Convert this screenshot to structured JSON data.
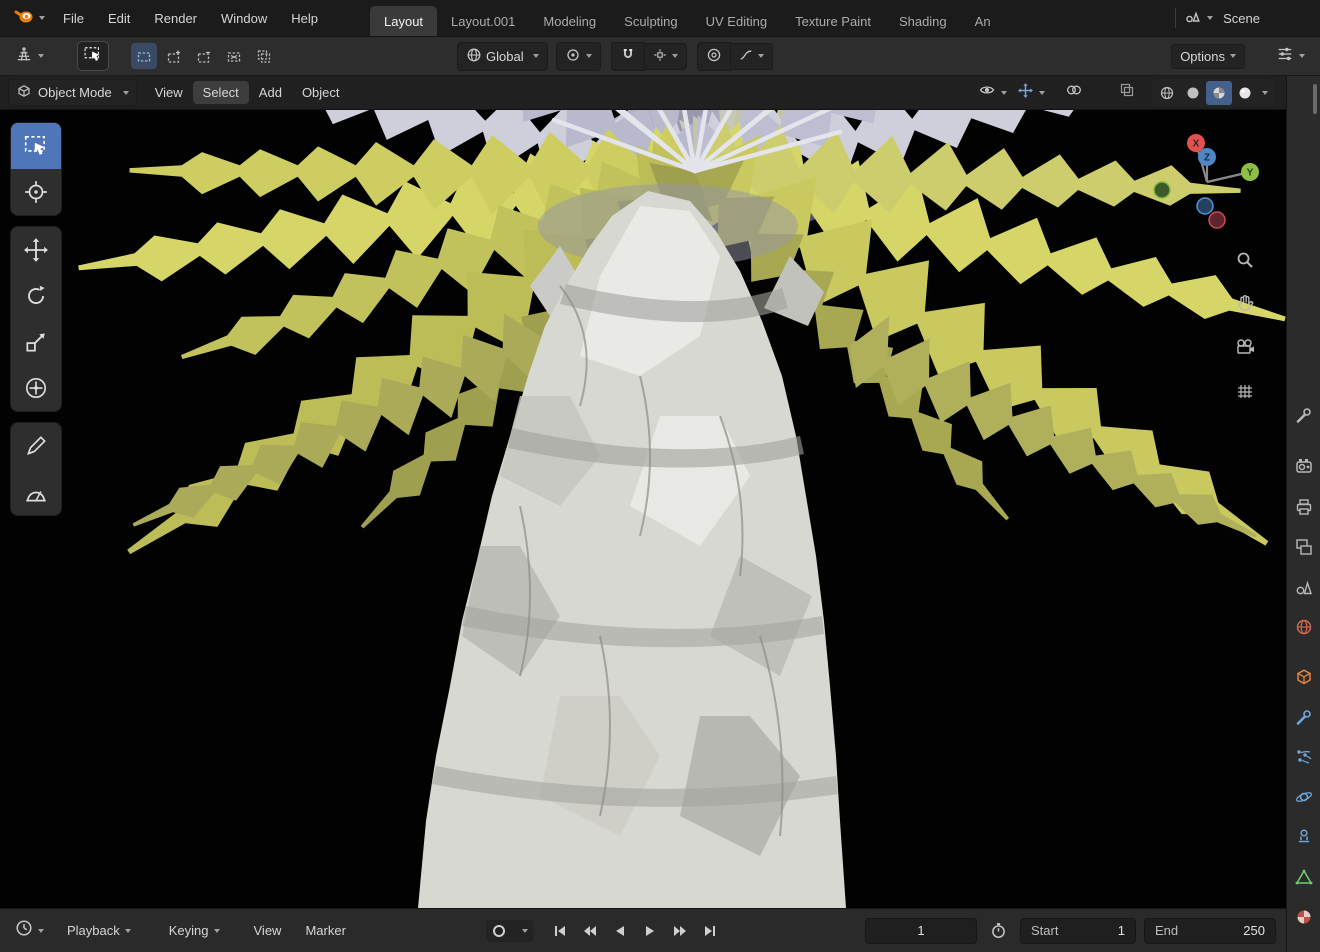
{
  "topbar": {
    "menus": [
      "File",
      "Edit",
      "Render",
      "Window",
      "Help"
    ],
    "tabs": [
      "Layout",
      "Layout.001",
      "Modeling",
      "Sculpting",
      "UV Editing",
      "Texture Paint",
      "Shading",
      "An"
    ],
    "active_tab": "Layout",
    "scene_label": "Scene"
  },
  "toolrow": {
    "orientation_value": "Global",
    "options_label": "Options"
  },
  "viewport_header": {
    "mode_value": "Object Mode",
    "menus": [
      "View",
      "Select",
      "Add",
      "Object"
    ]
  },
  "nav_gizmo": {
    "x_label": "X",
    "y_label": "Y",
    "z_label": "Z"
  },
  "timeline": {
    "playback_label": "Playback",
    "keying_label": "Keying",
    "view_label": "View",
    "marker_label": "Marker",
    "current_frame": "1",
    "start_label": "Start",
    "start_value": "1",
    "end_label": "End",
    "end_value": "250"
  },
  "colors": {
    "accent_blue": "#4772b3",
    "blender_orange": "#e87d0d"
  }
}
